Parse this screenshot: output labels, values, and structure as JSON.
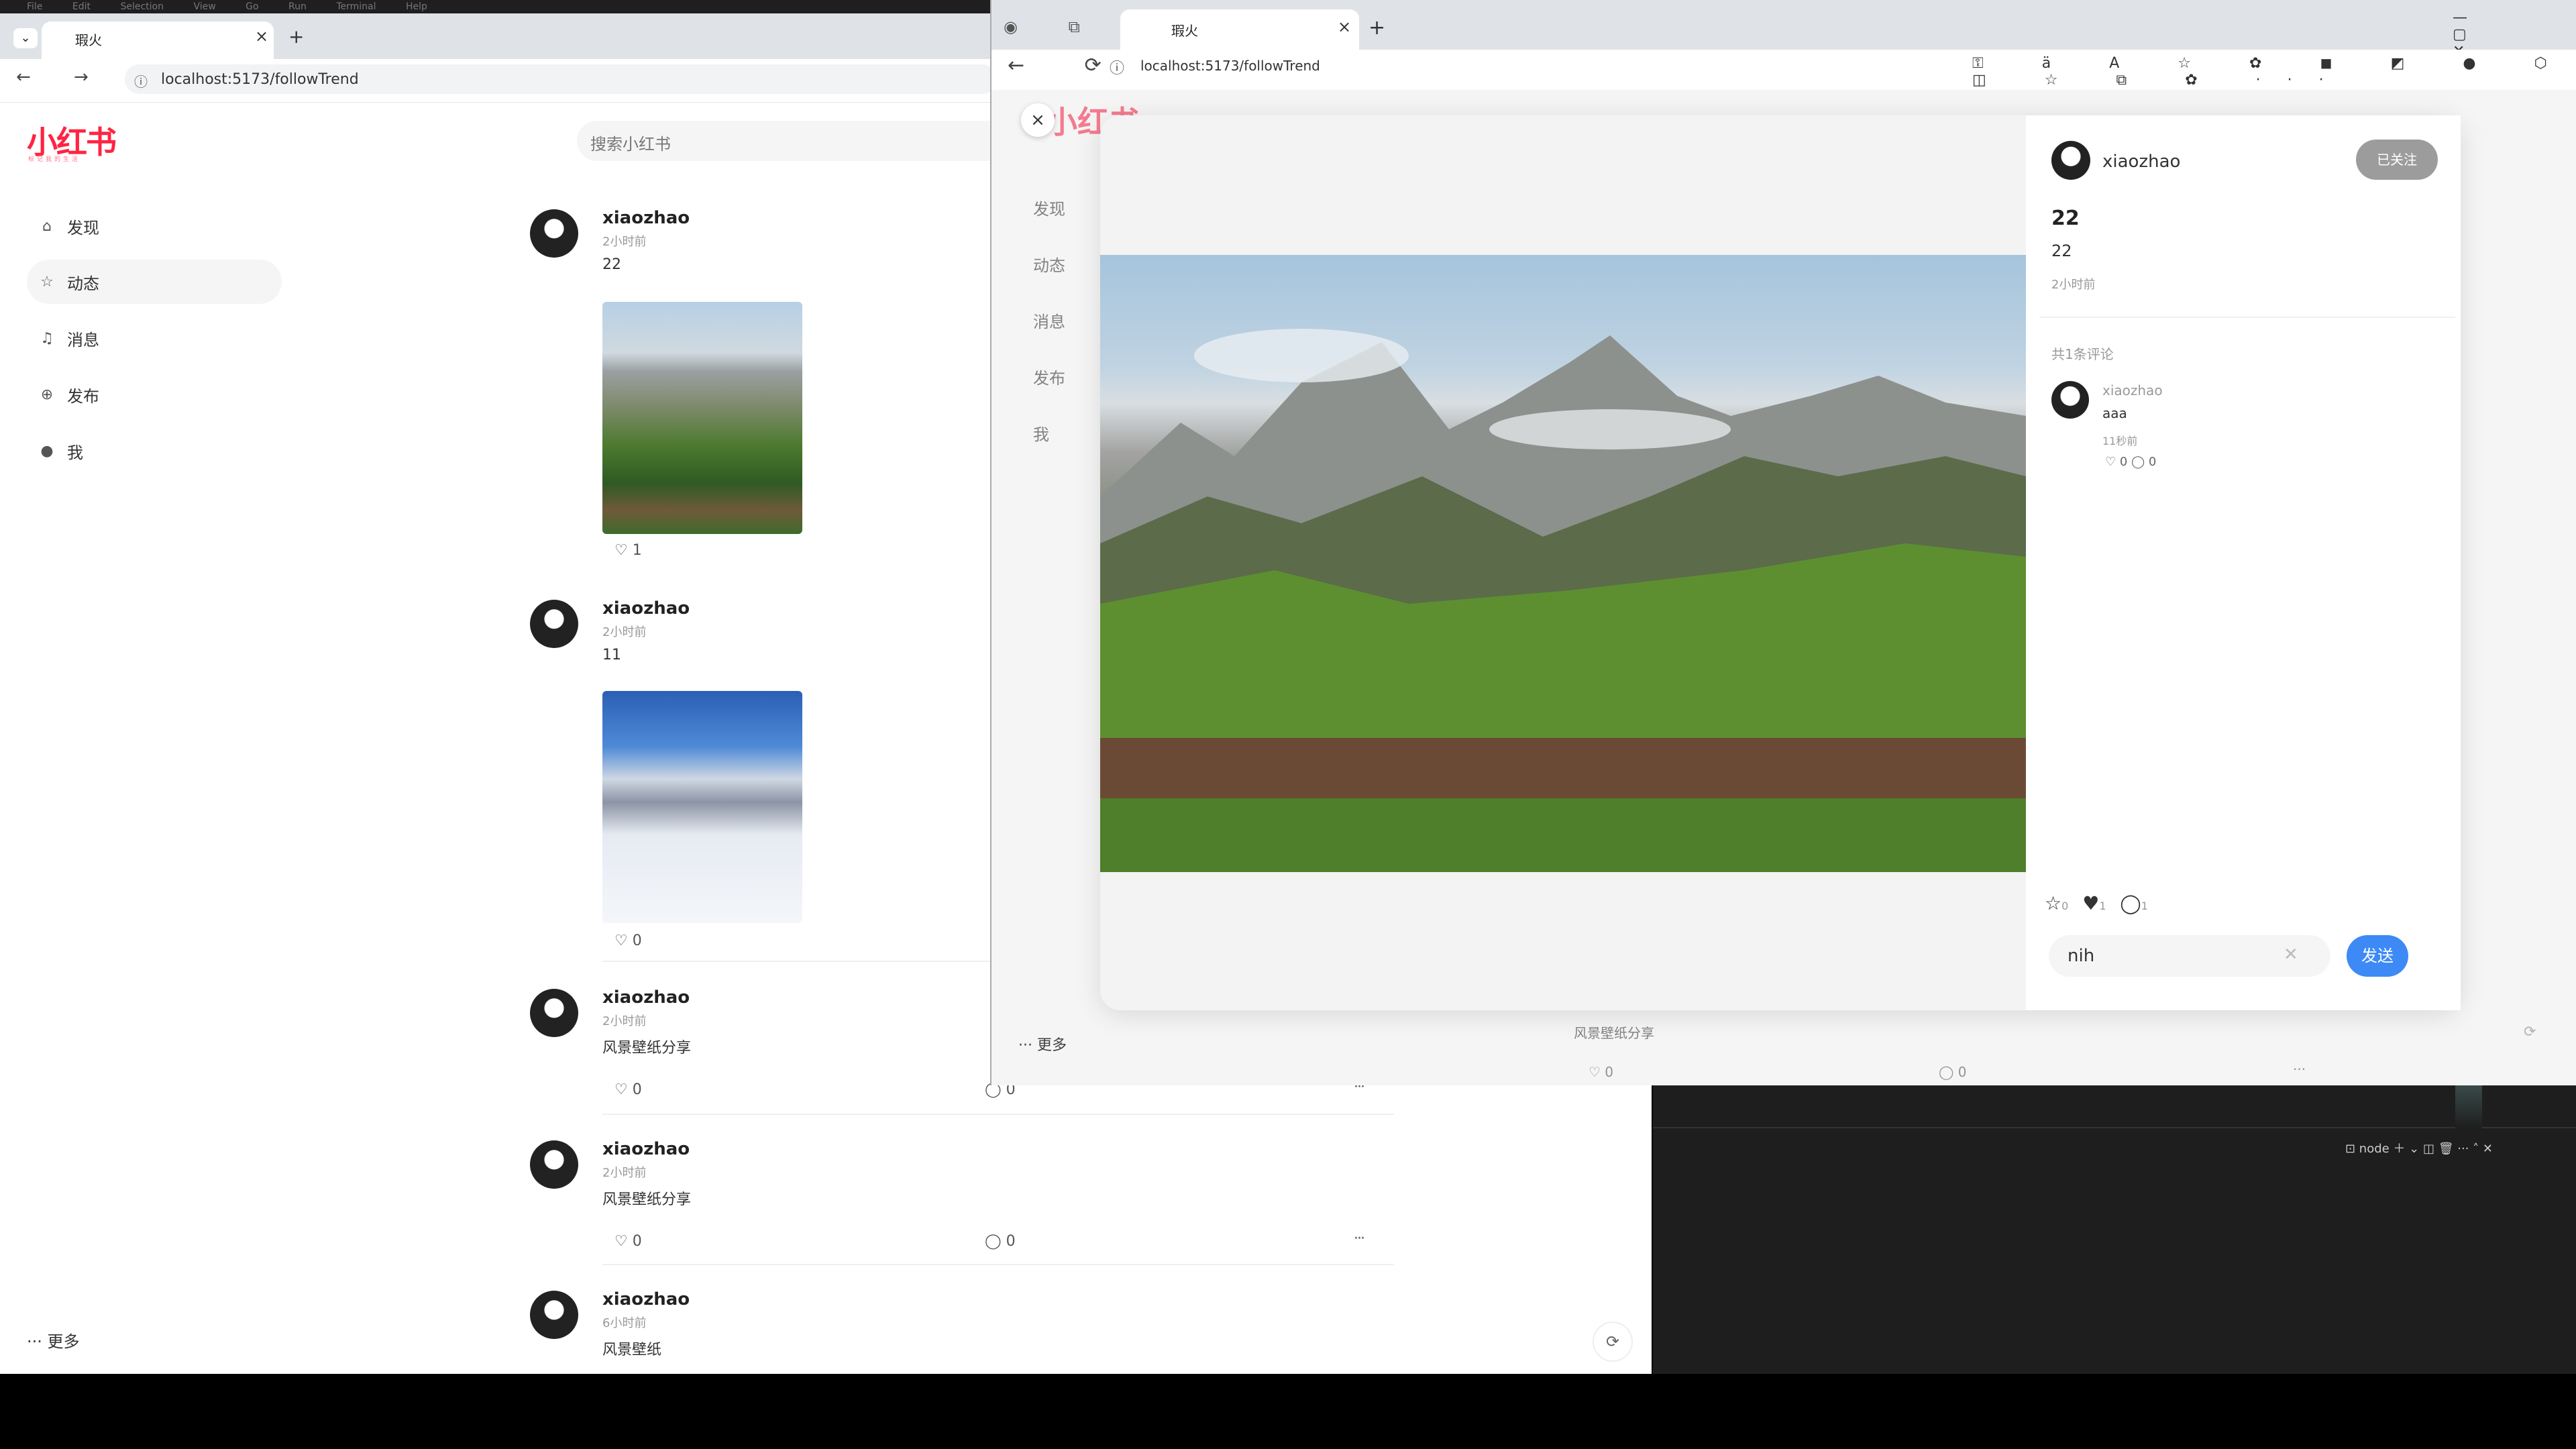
{
  "left_window": {
    "menu": [
      "File",
      "Edit",
      "Selection",
      "View",
      "Go",
      "Run",
      "Terminal",
      "Help"
    ],
    "tab_title": "瑕火",
    "tab_close": "×",
    "new_tab": "+",
    "tab_menu": "⌄",
    "nav_icons": "← → ⟳",
    "info_icon": "ⓘ",
    "url": "localhost:5173/followTrend",
    "logo": "小红书",
    "logo_sub": "标记我的生活",
    "search_placeholder": "搜索小红书",
    "sidebar": [
      {
        "icon": "⌂",
        "label": "发现"
      },
      {
        "icon": "☆",
        "label": "动态"
      },
      {
        "icon": "♫",
        "label": "消息"
      },
      {
        "icon": "⊕",
        "label": "发布"
      },
      {
        "icon": "●",
        "label": "我"
      }
    ],
    "more": "··· 更多",
    "posts": [
      {
        "user": "xiaozhao",
        "time": "2小时前",
        "text": "22",
        "likes": "♡ 1",
        "comments": "",
        "has_image": "mountain"
      },
      {
        "user": "xiaozhao",
        "time": "2小时前",
        "text": "11",
        "likes": "♡ 0",
        "comments": "",
        "has_image": "snow"
      },
      {
        "user": "xiaozhao",
        "time": "2小时前",
        "text": "风景壁纸分享",
        "likes": "♡ 0",
        "comments": "◯ 0",
        "menu": "···"
      },
      {
        "user": "xiaozhao",
        "time": "2小时前",
        "text": "风景壁纸分享",
        "likes": "♡ 0",
        "comments": "◯ 0",
        "menu": "···"
      },
      {
        "user": "xiaozhao",
        "time": "6小时前",
        "text": "风景壁纸"
      }
    ],
    "refresh_icon": "⟳"
  },
  "right_window": {
    "tab_title": "瑕火",
    "tab_close": "×",
    "new_tab": "+",
    "tab_icons": "◉ ⧉ ▢",
    "window_controls": "— ▢ ✕",
    "nav_icons": "← ⟳",
    "info_icon": "ⓘ",
    "url": "localhost:5173/followTrend",
    "toolbar_icons": "⚿ ä A ☆ ✿ ◼ ◩ ● ⬡ ◫ ☆ ⧉ ✿ ···",
    "bg_logo": "小红书",
    "bg_sidebar": [
      "发现",
      "动态",
      "消息",
      "发布",
      "我"
    ],
    "bg_more": "··· 更多",
    "bg_caption": "风景壁纸分享",
    "bg_like": "♡ 0",
    "bg_comment": "◯ 0",
    "bg_menu": "···",
    "bg_refresh": "⟳",
    "modal": {
      "close": "×",
      "author": "xiaozhao",
      "follow_button": "已关注",
      "title": "22",
      "desc": "22",
      "time": "2小时前",
      "comment_count_label": "共1条评论",
      "comments": [
        {
          "user": "xiaozhao",
          "text": "aaa",
          "time": "11秒前",
          "actions": "♡ 0  ◯ 0"
        }
      ],
      "stats": {
        "collect": "☆",
        "collect_count": "0",
        "like": "♥",
        "like_count": "1",
        "comment": "◯",
        "comment_count": "1"
      },
      "input_value": "nih",
      "input_clear": "✕",
      "send_button": "发送"
    }
  },
  "terminal": {
    "tools": "⊡ node ＋ ⌄ ◫ 🗑 ··· ˄ ✕"
  },
  "colors": {
    "brand": "#ff2442",
    "send": "#3d8af7",
    "follow_btn": "#9c9c9c"
  }
}
